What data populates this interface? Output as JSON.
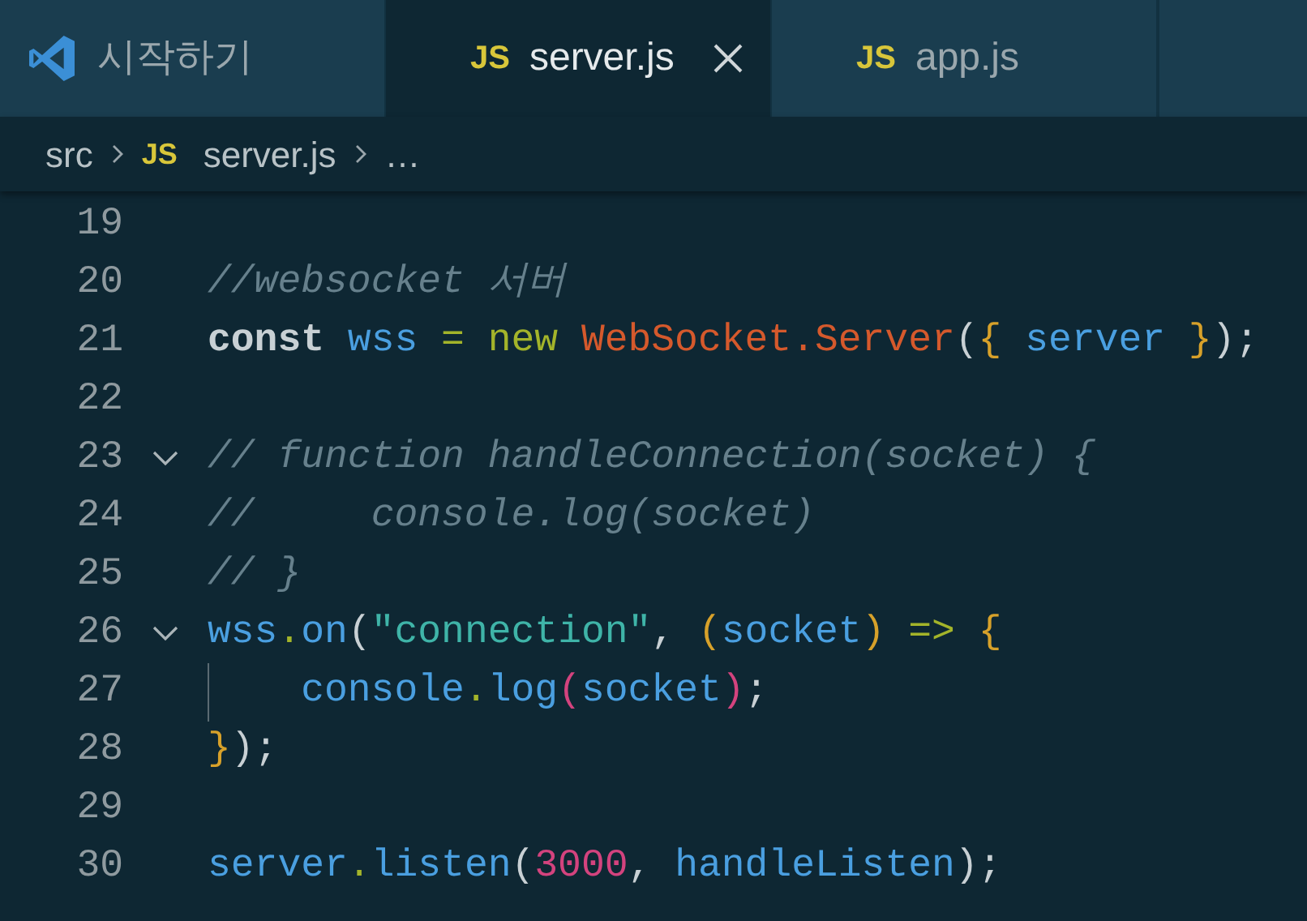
{
  "tabs": [
    {
      "kind": "logo",
      "label": "시작하기",
      "selected": false
    },
    {
      "kind": "js",
      "icon_text": "JS",
      "label": "server.js",
      "selected": true
    },
    {
      "kind": "js",
      "icon_text": "JS",
      "label": "app.js",
      "selected": false
    }
  ],
  "breadcrumb": [
    {
      "kind": "folder",
      "label": "src"
    },
    {
      "kind": "file",
      "icon_text": "JS",
      "label": "server.js"
    },
    {
      "kind": "more",
      "label": "…"
    }
  ],
  "lines": [
    {
      "number": "19",
      "kind": "plain"
    },
    {
      "number": "20",
      "kind": "plain",
      "tokens": [
        {
          "kind": "comment",
          "text": "//websocket 서버"
        }
      ]
    },
    {
      "number": "21",
      "kind": "plain",
      "tokens": [
        {
          "kind": "keyword",
          "text": "const"
        },
        {
          "kind": "variable",
          "text": " wss"
        },
        {
          "kind": "operator",
          "text": " ="
        },
        {
          "kind": "new",
          "text": " new"
        },
        {
          "kind": "class",
          "text": " WebSocket.Server"
        },
        {
          "kind": "punct",
          "text": "("
        },
        {
          "kind": "brace",
          "text": "{"
        },
        {
          "kind": "variable",
          "text": " server"
        },
        {
          "kind": "brace",
          "text": " }"
        },
        {
          "kind": "punct",
          "text": ");"
        }
      ]
    },
    {
      "number": "22",
      "kind": "plain"
    },
    {
      "number": "23",
      "kind": "fold",
      "expanded": true,
      "tokens": [
        {
          "kind": "comment",
          "text": "// function handleConnection(socket) {"
        }
      ]
    },
    {
      "number": "24",
      "kind": "plain",
      "tokens": [
        {
          "kind": "comment",
          "text": "//     console.log(socket)"
        }
      ]
    },
    {
      "number": "25",
      "kind": "plain",
      "tokens": [
        {
          "kind": "comment",
          "text": "// }"
        }
      ]
    },
    {
      "number": "26",
      "kind": "fold",
      "expanded": true,
      "tokens": [
        {
          "kind": "variable",
          "text": "wss"
        },
        {
          "kind": "dot",
          "text": "."
        },
        {
          "kind": "variable",
          "text": "on"
        },
        {
          "kind": "punct",
          "text": "("
        },
        {
          "kind": "string",
          "text": "\"connection\""
        },
        {
          "kind": "punct",
          "text": ", "
        },
        {
          "kind": "brace",
          "text": "("
        },
        {
          "kind": "variable",
          "text": "socket"
        },
        {
          "kind": "brace",
          "text": ")"
        },
        {
          "kind": "operator",
          "text": " =>"
        },
        {
          "kind": "brace",
          "text": " {"
        }
      ]
    },
    {
      "number": "27",
      "kind": "indented",
      "tokens": [
        {
          "kind": "variable",
          "text": "console"
        },
        {
          "kind": "dot",
          "text": "."
        },
        {
          "kind": "variable",
          "text": "log"
        },
        {
          "kind": "paren2",
          "text": "("
        },
        {
          "kind": "variable",
          "text": "socket"
        },
        {
          "kind": "paren2",
          "text": ")"
        },
        {
          "kind": "punct",
          "text": ";"
        }
      ]
    },
    {
      "number": "28",
      "kind": "plain",
      "tokens": [
        {
          "kind": "brace",
          "text": "}"
        },
        {
          "kind": "punct",
          "text": ");"
        }
      ]
    },
    {
      "number": "29",
      "kind": "plain"
    },
    {
      "number": "30",
      "kind": "plain",
      "tokens": [
        {
          "kind": "variable",
          "text": "server"
        },
        {
          "kind": "dot",
          "text": "."
        },
        {
          "kind": "variable",
          "text": "listen"
        },
        {
          "kind": "punct",
          "text": "("
        },
        {
          "kind": "number",
          "text": "3000"
        },
        {
          "kind": "punct",
          "text": ", "
        },
        {
          "kind": "variable",
          "text": "handleListen"
        },
        {
          "kind": "punct",
          "text": ");"
        }
      ]
    }
  ]
}
